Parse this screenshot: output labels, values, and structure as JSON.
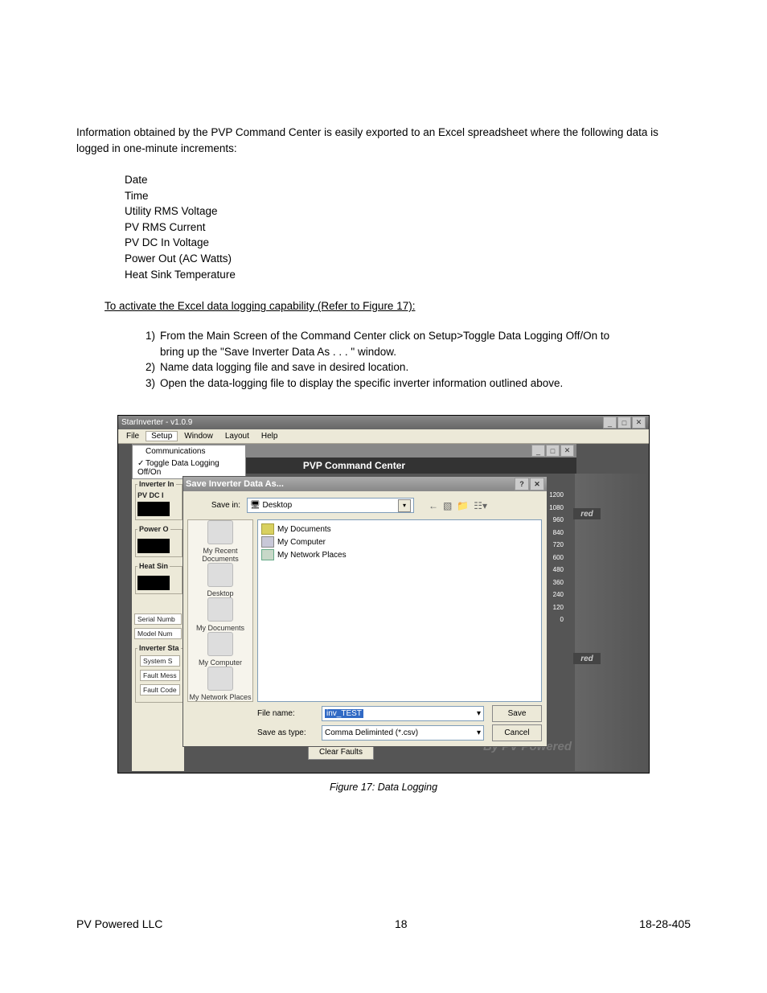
{
  "intro": "Information obtained by the PVP Command Center is easily exported to an Excel spreadsheet where the following data is logged in one-minute increments:",
  "specs": [
    "Date",
    "Time",
    "Utility RMS Voltage",
    "PV RMS Current",
    "PV DC In Voltage",
    "Power Out (AC Watts)",
    "Heat Sink Temperature"
  ],
  "activate_heading": "To activate the Excel data logging capability (Refer to Figure 17):",
  "steps": [
    "From the Main Screen of the Command Center click on Setup>Toggle Data Logging Off/On to bring up the \"Save Inverter Data As . . . \" window.",
    "Name data logging file and save in desired location.",
    "Open the data-logging file to display the specific inverter information outlined above."
  ],
  "win": {
    "app_title": "StarInverter - v1.0.9",
    "menus": [
      "File",
      "Setup",
      "Window",
      "Layout",
      "Help"
    ],
    "setup_items": [
      "Communications",
      "Toggle Data Logging Off/On"
    ],
    "pvp_title": "PVP Command Center",
    "left": {
      "group1": "Inverter In",
      "pvdc": "PV DC I",
      "group2": "Power O",
      "group3": "Heat Sin",
      "serial": "Serial Numb",
      "model": "Model Num",
      "status_group": "Inverter Sta",
      "system": "System S",
      "fault_mes": "Fault Mess",
      "fault_code": "Fault Code"
    },
    "clear_faults": "Clear Faults",
    "ticks": [
      "1200",
      "1080",
      "960",
      "840",
      "720",
      "600",
      "480",
      "360",
      "240",
      "120",
      "0"
    ],
    "brand": "By PV Powered",
    "red": "red"
  },
  "dlg": {
    "title": "Save Inverter Data As...",
    "save_in_lbl": "Save in:",
    "save_in_val": "Desktop",
    "places": [
      "My Recent Documents",
      "Desktop",
      "My Documents",
      "My Computer",
      "My Network Places"
    ],
    "files": [
      {
        "icon": "folder",
        "name": "My Documents"
      },
      {
        "icon": "comp",
        "name": "My Computer"
      },
      {
        "icon": "net",
        "name": "My Network Places"
      }
    ],
    "file_name_lbl": "File name:",
    "file_name_val": "inv_TEST",
    "save_as_type_lbl": "Save as type:",
    "save_as_type_val": "Comma Deliminted (*.csv)",
    "save_btn": "Save",
    "cancel_btn": "Cancel"
  },
  "caption": "Figure 17:  Data Logging",
  "footer": {
    "left": "PV Powered LLC",
    "center": "18",
    "right": "18-28-405"
  }
}
